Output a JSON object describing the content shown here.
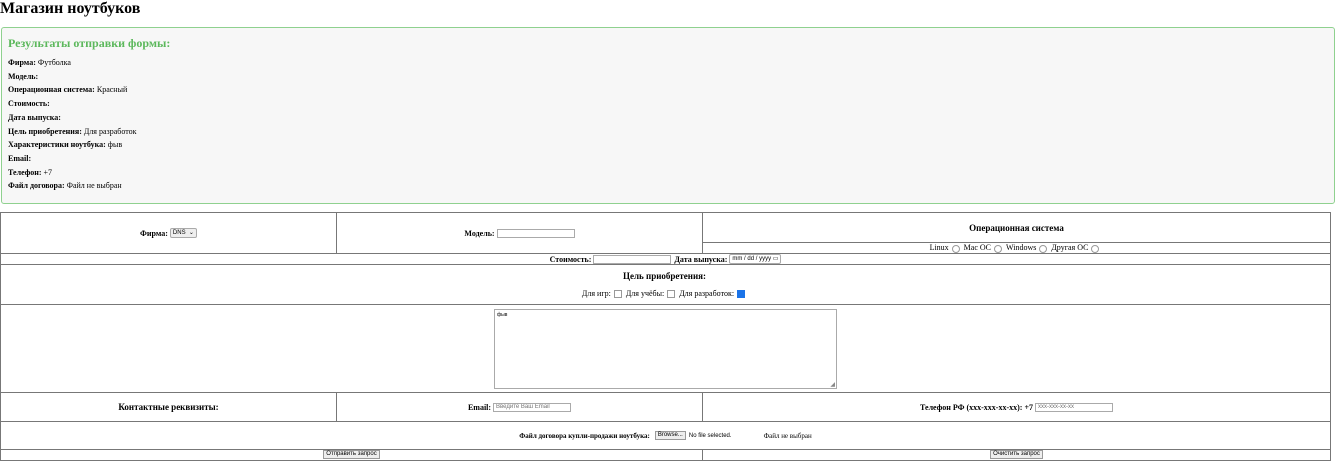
{
  "title": "Магазин ноутбуков",
  "results": {
    "heading": "Результаты отправки формы:",
    "items": [
      {
        "label": "Фирма:",
        "value": "Футболка"
      },
      {
        "label": "Модель:",
        "value": ""
      },
      {
        "label": "Операционная система:",
        "value": "Красный"
      },
      {
        "label": "Стоимость:",
        "value": ""
      },
      {
        "label": "Дата выпуска:",
        "value": ""
      },
      {
        "label": "Цель приобретения:",
        "value": "Для разработок"
      },
      {
        "label": "Характеристики ноутбука:",
        "value": "фыв"
      },
      {
        "label": "Email:",
        "value": ""
      },
      {
        "label": "Телефон:",
        "value": "+7"
      },
      {
        "label": "Файл договора:",
        "value": "Файл не выбран"
      }
    ]
  },
  "form": {
    "firm_label": "Фирма:",
    "firm_value": "DNS",
    "model_label": "Модель:",
    "os_heading": "Операционная система",
    "os_options": [
      "Linux",
      "Mac OC",
      "Windows",
      "Другая ОС"
    ],
    "cost_label": "Стоимость:",
    "date_label": "Дата выпуска:",
    "date_placeholder": "mm / dd / yyyy",
    "purpose_heading": "Цель приобретения:",
    "purpose_options": [
      {
        "label": "Для игр:",
        "checked": false
      },
      {
        "label": "Для учёбы:",
        "checked": false
      },
      {
        "label": "Для разработок:",
        "checked": true
      }
    ],
    "specs_value": "фыв",
    "contacts_label": "Контактные реквизиты:",
    "email_label": "Email:",
    "email_placeholder": "Введите Ваш Email",
    "phone_label": "Телефон РФ (xxx-xxx-xx-xx): +7",
    "phone_placeholder": "xxx-xxx-xx-xx",
    "file_label": "Файл договора купли-продажи ноутбука:",
    "browse": "Browse...",
    "no_file": "No file selected.",
    "file_status": "Файл не выбран",
    "submit": "Отправить запрос",
    "reset": "Очистить запрос"
  }
}
